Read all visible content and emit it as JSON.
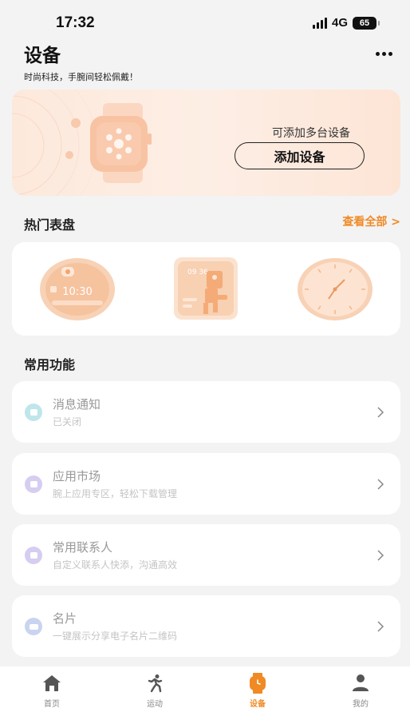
{
  "status_bar": {
    "time": "17:32",
    "network": "4G",
    "battery": "65"
  },
  "header": {
    "title": "设备",
    "subtitle": "时尚科技，手腕间轻松佩戴！"
  },
  "banner": {
    "tip": "可添加多台设备",
    "add_device_label": "添加设备"
  },
  "popular_dials": {
    "title": "热门表盘",
    "view_all_label": "查看全部 >",
    "dials": [
      {
        "time_text": "10:30"
      },
      {
        "time_text": "09 36"
      },
      {
        "time_text": ""
      }
    ]
  },
  "features": {
    "title": "常用功能",
    "items": [
      {
        "name": "消息通知",
        "desc": "已关闭",
        "icon": "message-icon",
        "color": "#bfe6ea"
      },
      {
        "name": "应用市场",
        "desc": "腕上应用专区，轻松下载管理",
        "icon": "bag-icon",
        "color": "#d6cdf0"
      },
      {
        "name": "常用联系人",
        "desc": "自定义联系人快添，沟通高效",
        "icon": "contact-icon",
        "color": "#d6cdf0"
      },
      {
        "name": "名片",
        "desc": "一键展示分享电子名片二维码",
        "icon": "card-icon",
        "color": "#c9d4f0"
      }
    ]
  },
  "tab_bar": {
    "items": [
      {
        "label": "首页",
        "icon": "home-icon"
      },
      {
        "label": "运动",
        "icon": "run-icon"
      },
      {
        "label": "设备",
        "icon": "watch-icon",
        "active": true
      },
      {
        "label": "我的",
        "icon": "user-icon"
      }
    ]
  },
  "colors": {
    "accent": "#f08a24",
    "banner_bg": "#fdeee5"
  }
}
